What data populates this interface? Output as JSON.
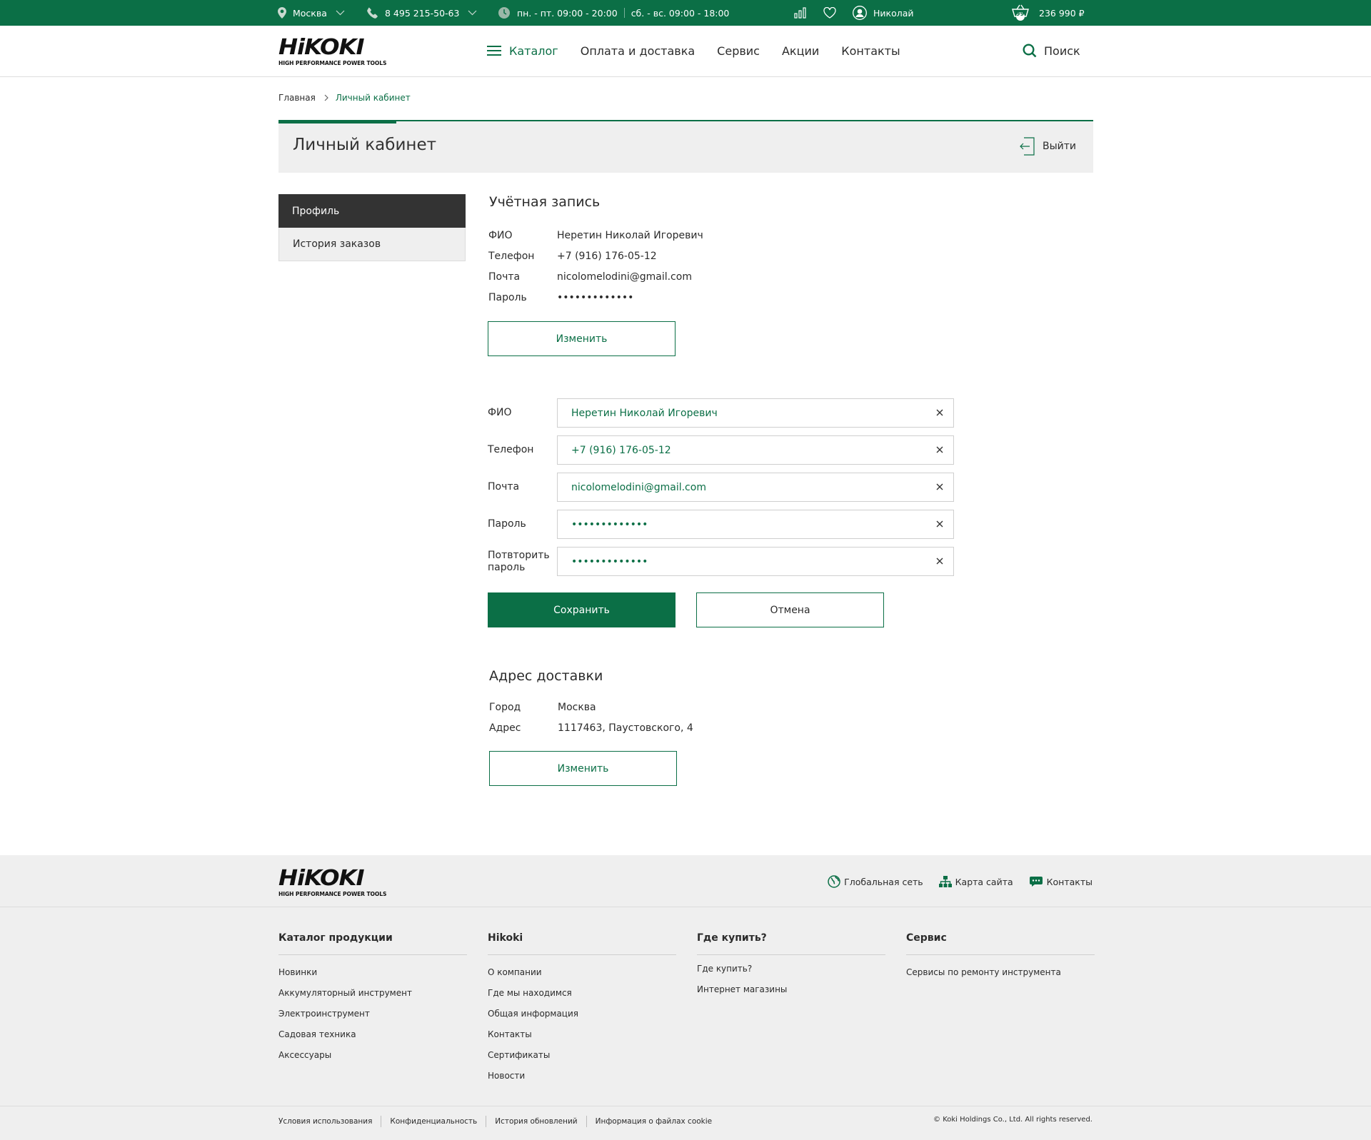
{
  "topbar": {
    "city": "Москва",
    "phone": "8 495 215-50-63",
    "hours_weekday": "пн. - пт. 09:00 - 20:00",
    "hours_weekend": "сб. - вс. 09:00 - 18:00",
    "user_name": "Николай",
    "cart_count": "99",
    "cart_total": "236 990 ₽"
  },
  "brand": {
    "logo_text": "HiKOKI",
    "tagline": "HIGH PERFORMANCE POWER TOOLS"
  },
  "nav": {
    "items": [
      "Каталог",
      "Оплата и доставка",
      "Сервис",
      "Акции",
      "Контакты"
    ],
    "search_label": "Поиск"
  },
  "breadcrumb": {
    "home": "Главная",
    "current": "Личный кабинет"
  },
  "page": {
    "title": "Личный кабинет",
    "logout_label": "Выйти"
  },
  "sidebar": {
    "items": [
      "Профиль",
      "История заказов"
    ],
    "active_index": 0
  },
  "account": {
    "title": "Учётная запись",
    "rows": [
      {
        "label": "ФИО",
        "value": "Неретин Николай Игоревич"
      },
      {
        "label": "Телефон",
        "value": "+7 (916) 176-05-12"
      },
      {
        "label": "Почта",
        "value": "nicolomelodini@gmail.com"
      },
      {
        "label": "Пароль",
        "value": "•••••••••••••"
      }
    ],
    "edit_label": "Изменить"
  },
  "form": {
    "fields": [
      {
        "label": "ФИО",
        "value": "Неретин Николай Игоревич"
      },
      {
        "label": "Телефон",
        "value": "+7 (916) 176-05-12"
      },
      {
        "label": "Почта",
        "value": "nicolomelodini@gmail.com"
      },
      {
        "label": "Пароль",
        "value": "•••••••••••••"
      },
      {
        "label": "Потвторить пароль",
        "value": "•••••••••••••"
      }
    ],
    "save_label": "Сохранить",
    "cancel_label": "Отмена"
  },
  "delivery": {
    "title": "Адрес доставки",
    "rows": [
      {
        "label": "Город",
        "value": "Москва"
      },
      {
        "label": "Адрес",
        "value": "1117463, Паустовского, 4"
      }
    ],
    "edit_label": "Изменить"
  },
  "footer": {
    "links": [
      "Глобальная сеть",
      "Карта сайта",
      "Контакты"
    ],
    "columns": [
      {
        "title": "Каталог продукции",
        "items": [
          "Новинки",
          "Аккумуляторный инструмент",
          "Электроинструмент",
          "Садовая техника",
          "Аксессуары"
        ]
      },
      {
        "title": "Hikoki",
        "items": [
          "О компании",
          "Где мы находимся",
          "Общая информация",
          "Контакты",
          "Сертификаты",
          "Новости"
        ]
      },
      {
        "title": "Где купить?",
        "items": [
          "Где купить?",
          "Интернет магазины"
        ]
      },
      {
        "title": "Сервис",
        "items": [
          "Сервисы по ремонту инструмента"
        ]
      }
    ],
    "legal": [
      "Условия использования",
      "Конфиденциальность",
      "История обновлений",
      "Информация о файлах cookie"
    ],
    "copyright": "© Koki Holdings Co., Ltd. All rights reserved."
  },
  "colors": {
    "brand_green": "#0b6f46",
    "dark": "#333333",
    "light_bg": "#efefef"
  },
  "icons": [
    "location-pin-icon",
    "phone-icon",
    "clock-icon",
    "chevron-down-icon",
    "compare-icon",
    "heart-icon",
    "user-icon",
    "cart-icon",
    "menu-icon",
    "search-icon",
    "logout-icon",
    "clear-icon",
    "globe-icon",
    "sitemap-icon",
    "chat-icon"
  ]
}
